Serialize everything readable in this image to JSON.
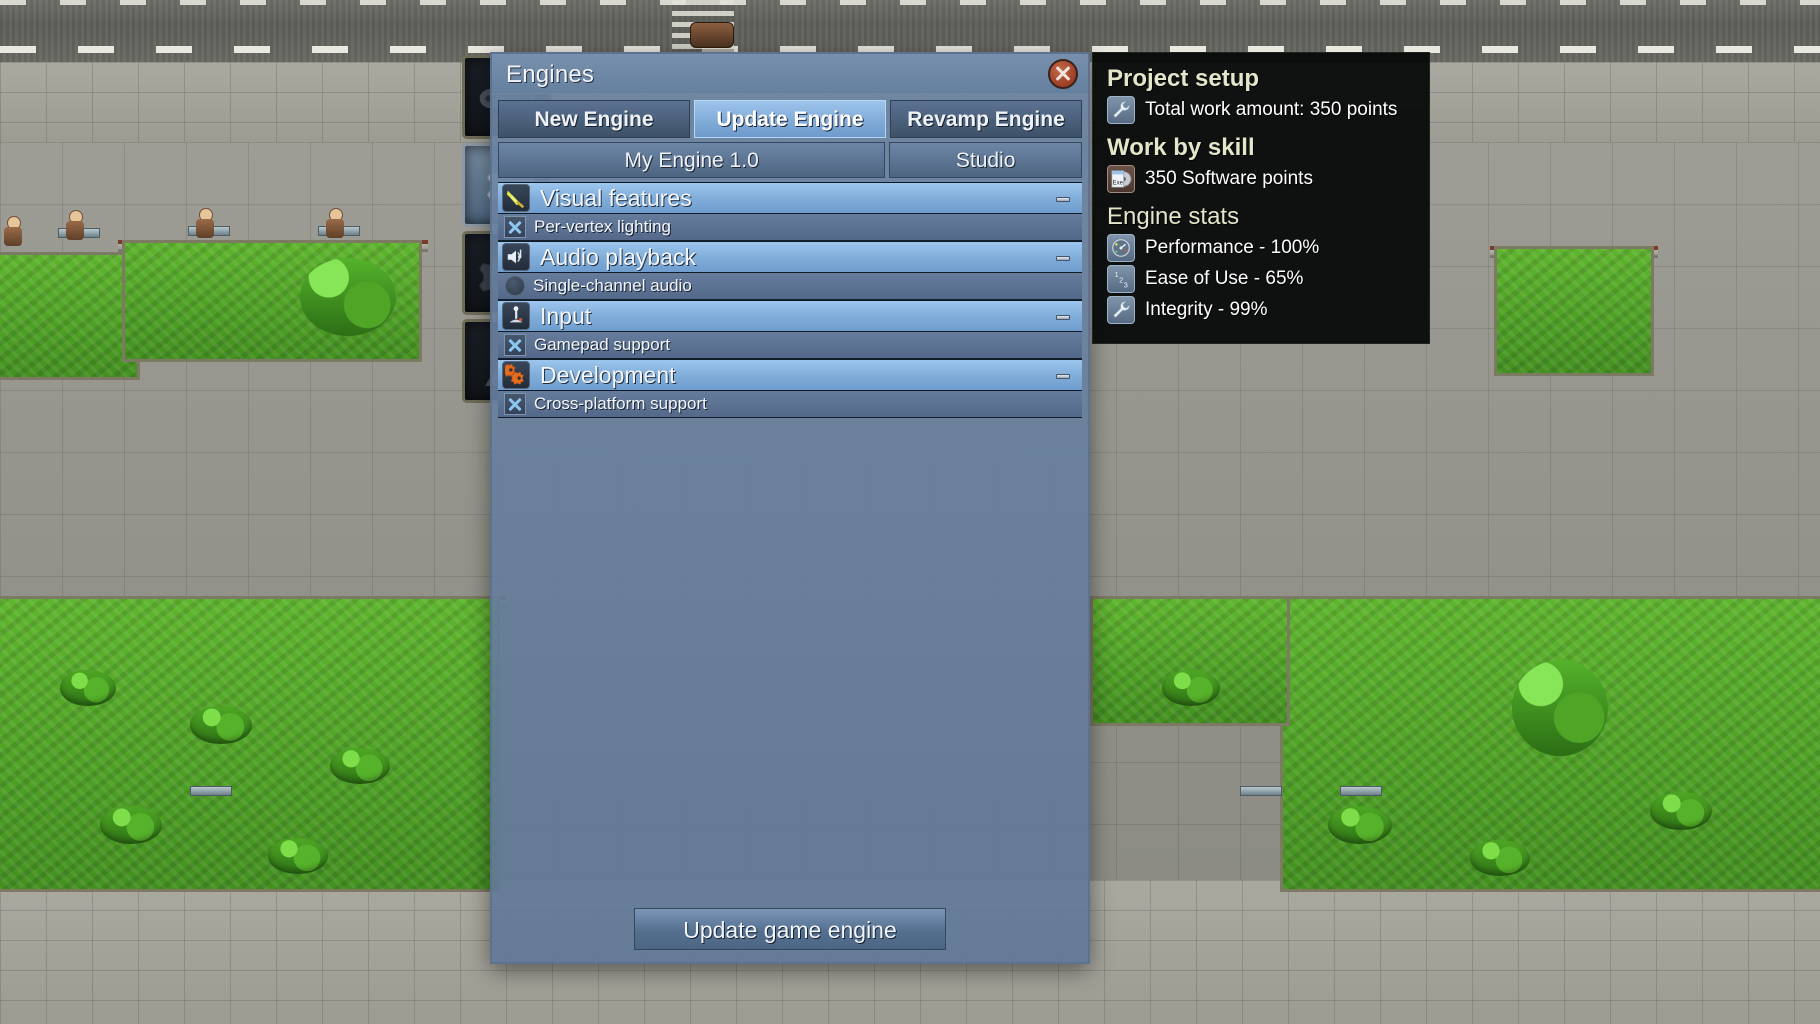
{
  "dialog": {
    "title": "Engines",
    "close_icon": "close-x-icon",
    "tabs": [
      {
        "label": "New Engine",
        "selected": false
      },
      {
        "label": "Update Engine",
        "selected": true
      },
      {
        "label": "Revamp Engine",
        "selected": false
      }
    ],
    "subtabs": [
      {
        "label": "My Engine 1.0",
        "width": "wide"
      },
      {
        "label": "Studio",
        "width": "narrow"
      }
    ],
    "collapse_marker": "-",
    "categories": [
      {
        "label": "Visual features",
        "icon": "flashlight-icon",
        "collapsed": "-",
        "items": [
          {
            "label": "Per-vertex lighting",
            "control": "checkbox-x"
          }
        ]
      },
      {
        "label": "Audio playback",
        "icon": "speaker-note-icon",
        "collapsed": "-",
        "items": [
          {
            "label": "Single-channel audio",
            "control": "radio-empty"
          }
        ]
      },
      {
        "label": "Input",
        "icon": "joystick-icon",
        "collapsed": "-",
        "items": [
          {
            "label": "Gamepad support",
            "control": "checkbox-x"
          }
        ]
      },
      {
        "label": "Development",
        "icon": "orange-gears-icon",
        "collapsed": "-",
        "items": [
          {
            "label": "Cross-platform support",
            "control": "checkbox-x"
          }
        ]
      }
    ],
    "primary_button": "Update game engine"
  },
  "info_panel": {
    "project_setup": {
      "heading": "Project setup",
      "rows": [
        {
          "icon": "wrench-icon",
          "text": "Total work amount: 350 points"
        }
      ]
    },
    "work_by_skill": {
      "heading": "Work by skill",
      "rows": [
        {
          "icon": "exe-disc-icon",
          "text": "350 Software points"
        }
      ]
    },
    "engine_stats": {
      "heading": "Engine stats",
      "rows": [
        {
          "icon": "gauge-icon",
          "text": "Performance - 100%"
        },
        {
          "icon": "numbers-icon",
          "text": "Ease of Use - 65%"
        },
        {
          "icon": "wrench-icon",
          "text": "Integrity - 99%"
        }
      ]
    }
  },
  "tool_column": [
    {
      "name": "gamepad-tool",
      "icon": "gamepad-icon",
      "active": false
    },
    {
      "name": "engine-tool",
      "icon": "gears-icon",
      "active": true
    },
    {
      "name": "finance-tool",
      "icon": "gears-dollar-icon",
      "active": false
    },
    {
      "name": "research-tool",
      "icon": "flask-icon",
      "active": false
    }
  ],
  "colors": {
    "accent_selected_tab": "#9dc4ec",
    "category_row": "#7fabd8",
    "panel_bg": "#040606",
    "heading_text": "#e3e6c8",
    "close_button": "#9c3f26"
  }
}
